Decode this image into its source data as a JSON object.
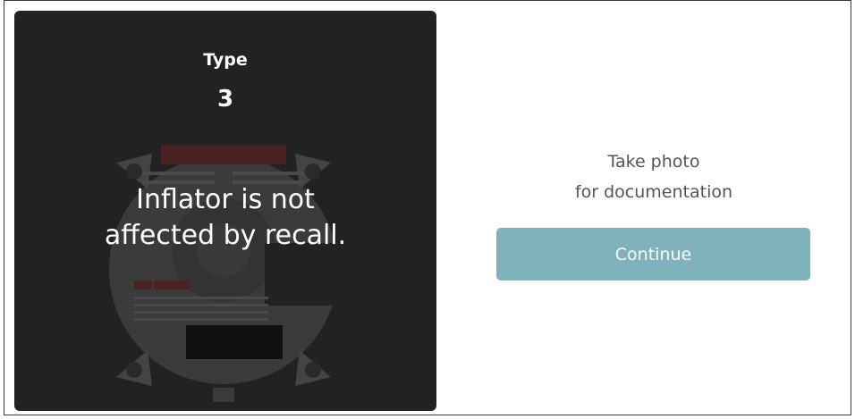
{
  "result": {
    "type_label": "Type",
    "type_number": "3",
    "message_line1": "Inflator is not",
    "message_line2": "affected by recall."
  },
  "instruction": {
    "line1": "Take photo",
    "line2": "for documentation"
  },
  "actions": {
    "continue_label": "Continue"
  },
  "colors": {
    "card_background": "#222222",
    "button_background": "#7fb2bd",
    "instruction_text": "#555555"
  }
}
